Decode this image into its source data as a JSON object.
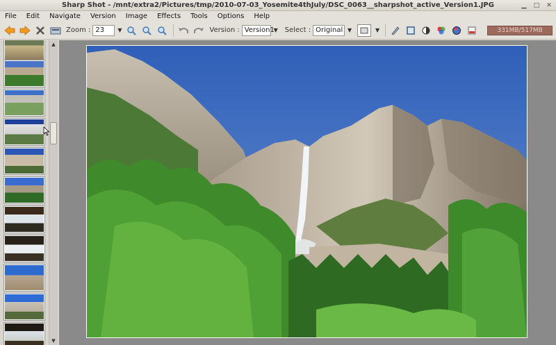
{
  "window": {
    "title": "Sharp Shot - /mnt/extra2/Pictures/tmp/2010-07-03_Yosemite4thJuly/DSC_0063__sharpshot_active_Version1.JPG"
  },
  "menu": {
    "items": [
      "File",
      "Edit",
      "Navigate",
      "Version",
      "Image",
      "Effects",
      "Tools",
      "Options",
      "Help"
    ]
  },
  "toolbar": {
    "zoom_label": "Zoom :",
    "zoom_value": "23",
    "version_label": "Version :",
    "version_value": "Version1",
    "select_label": "Select :",
    "select_value": "Original",
    "memory": "331MB/517MB"
  },
  "colors": {
    "canvas_bg": "#8a8a8a",
    "memory_bar": "#9b6a5c"
  },
  "icons": {
    "wm": [
      "minimize-icon",
      "maximize-icon",
      "close-icon"
    ],
    "toolbar": [
      "back-arrow-icon",
      "forward-arrow-icon",
      "delete-icon",
      "scanner-icon",
      "zoom-in-icon",
      "zoom-out-icon",
      "zoom-fit-icon",
      "undo-icon",
      "redo-icon",
      "frame-icon",
      "pen-icon",
      "crop-icon",
      "contrast-icon",
      "color-icon",
      "effects-icon",
      "paint-icon"
    ]
  }
}
